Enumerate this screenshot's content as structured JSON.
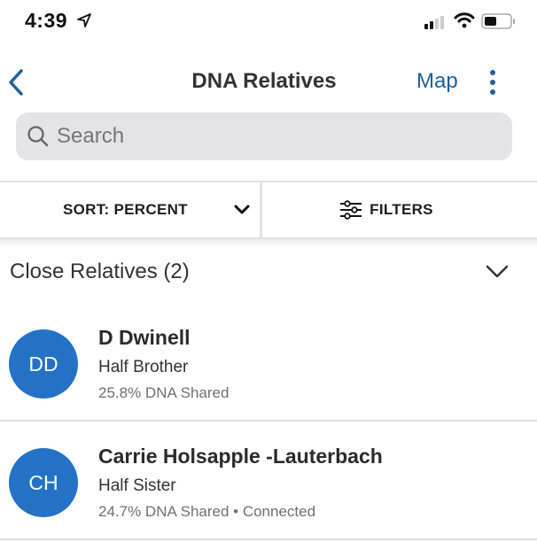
{
  "status_bar": {
    "time": "4:39",
    "icons": [
      "location-arrow-icon",
      "cellular-signal-icon",
      "wifi-icon",
      "battery-icon"
    ]
  },
  "nav": {
    "back_icon": "chevron-left-icon",
    "title": "DNA Relatives",
    "map_label": "Map",
    "more_icon": "vertical-ellipsis-icon"
  },
  "search": {
    "placeholder": "Search",
    "value": "",
    "icon": "search-icon"
  },
  "controls": {
    "sort_label": "SORT: PERCENT",
    "sort_icon": "chevron-down-icon",
    "filters_label": "FILTERS",
    "filters_icon": "sliders-icon"
  },
  "section": {
    "title": "Close Relatives (2)",
    "chevron_icon": "chevron-down-icon"
  },
  "relatives": [
    {
      "initials": "DD",
      "name": "D Dwinell",
      "relationship": "Half Brother",
      "dna_info": "25.8% DNA Shared"
    },
    {
      "initials": "CH",
      "name": "Carrie Holsapple -Lauterbach",
      "relationship": "Half Sister",
      "dna_info": "24.7% DNA Shared • Connected"
    }
  ],
  "colors": {
    "accent": "#1f5f9e",
    "avatar": "#2372c6",
    "search_bg": "#e4e4e6"
  }
}
